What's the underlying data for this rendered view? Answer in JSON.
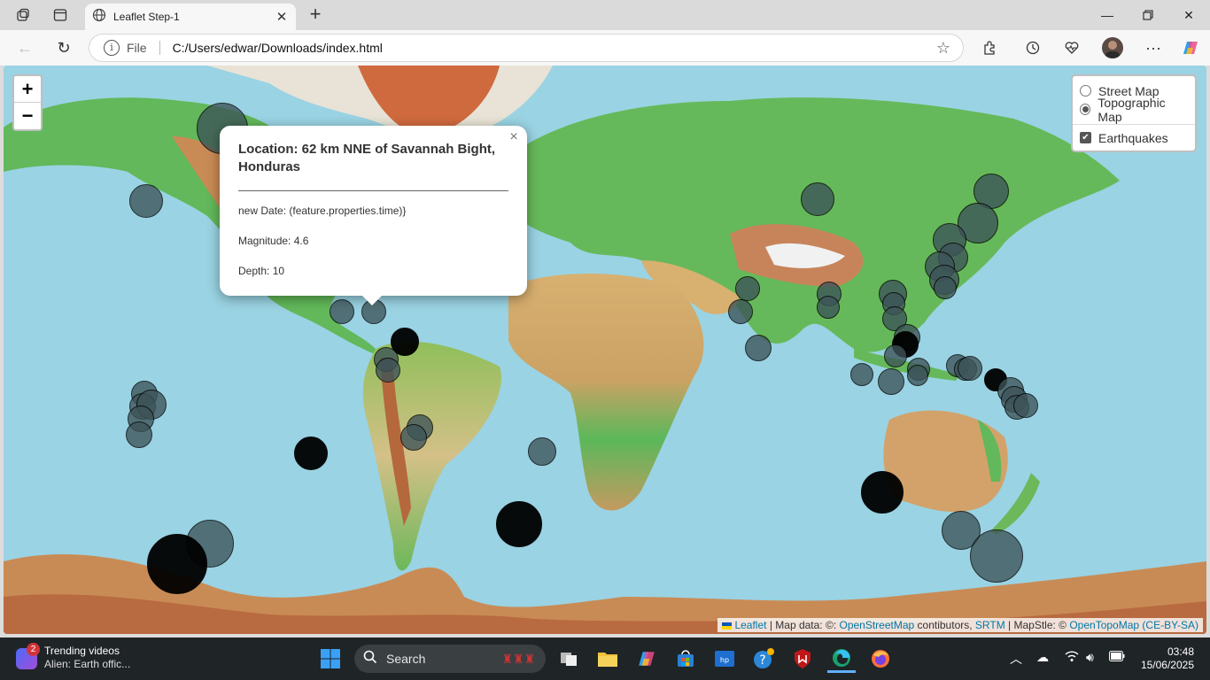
{
  "browser": {
    "tab_title": "Leaflet Step-1",
    "url_scheme_label": "File",
    "url": "C:/Users/edwar/Downloads/index.html"
  },
  "map": {
    "zoom_in": "+",
    "zoom_out": "−",
    "layers": {
      "base": [
        {
          "label": "Street Map",
          "selected": false
        },
        {
          "label": "Topographic Map",
          "selected": true
        }
      ],
      "overlays": [
        {
          "label": "Earthquakes",
          "checked": true
        }
      ]
    },
    "popup": {
      "title": "Location: 62 km NNE of Savannah Bight, Honduras",
      "date_line": "new Date: (feature.properties.time)}",
      "magnitude_line": "Magnitude: 4.6",
      "depth_line": "Depth: 10",
      "close": "×"
    },
    "attribution": {
      "leaflet": "Leaflet",
      "sep1": " | Map data: ©: ",
      "osm": "OpenStreetMap",
      "contrib": " contibutors, ",
      "srtm": "SRTM",
      "mapstyle": " | MapStle: © ",
      "opentopo": "OpenTopoMap",
      "license_open": " (",
      "license": "CE-BY-SA",
      "license_close": ")"
    },
    "colors": {
      "ocean": "#9ad3e3",
      "land_low": "#5cb85c",
      "land_mid": "#d4c088",
      "land_high": "#b0704a",
      "ice": "#f2f2f2",
      "quake_shallow": "#3d5358",
      "quake_deep": "#000000"
    }
  },
  "taskbar": {
    "news_badge": "2",
    "news_title": "Trending videos",
    "news_subtitle": "Alien: Earth offic...",
    "search_label": "Search",
    "time": "03:48",
    "date": "15/06/2025"
  }
}
